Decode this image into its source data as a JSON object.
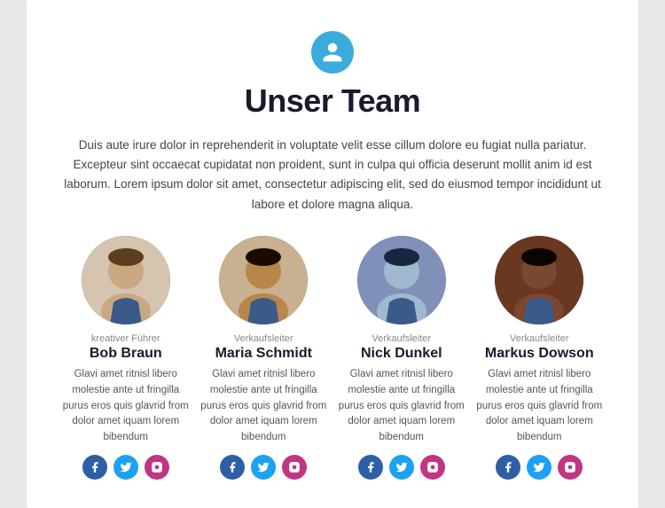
{
  "header": {
    "icon_label": "team-icon",
    "title": "Unser Team",
    "intro": "Duis aute irure dolor in reprehenderit in voluptate velit esse cillum dolore eu fugiat nulla pariatur. Excepteur sint occaecat cupidatat non proident, sunt in culpa qui officia deserunt mollit anim id est laborum. Lorem ipsum dolor sit amet, consectetur adipiscing elit, sed do eiusmod tempor incididunt ut labore et dolore magna aliqua."
  },
  "team": [
    {
      "role": "kreativer Führer",
      "name": "Bob Braun",
      "bio": "Glavi amet ritnisl libero molestie ante ut fringilla purus eros quis glavrid from dolor amet iquam lorem bibendum",
      "avatar_class": "avatar-1"
    },
    {
      "role": "Verkaufsleiter",
      "name": "Maria Schmidt",
      "bio": "Glavi amet ritnisl libero molestie ante ut fringilla purus eros quis glavrid from dolor amet iquam lorem bibendum",
      "avatar_class": "avatar-2"
    },
    {
      "role": "Verkaufsleiter",
      "name": "Nick Dunkel",
      "bio": "Glavi amet ritnisl libero molestie ante ut fringilla purus eros quis glavrid from dolor amet iquam lorem bibendum",
      "avatar_class": "avatar-3"
    },
    {
      "role": "Verkaufsleiter",
      "name": "Markus Dowson",
      "bio": "Glavi amet ritnisl libero molestie ante ut fringilla purus eros quis glavrid from dolor amet iquam lorem bibendum",
      "avatar_class": "avatar-4"
    }
  ]
}
